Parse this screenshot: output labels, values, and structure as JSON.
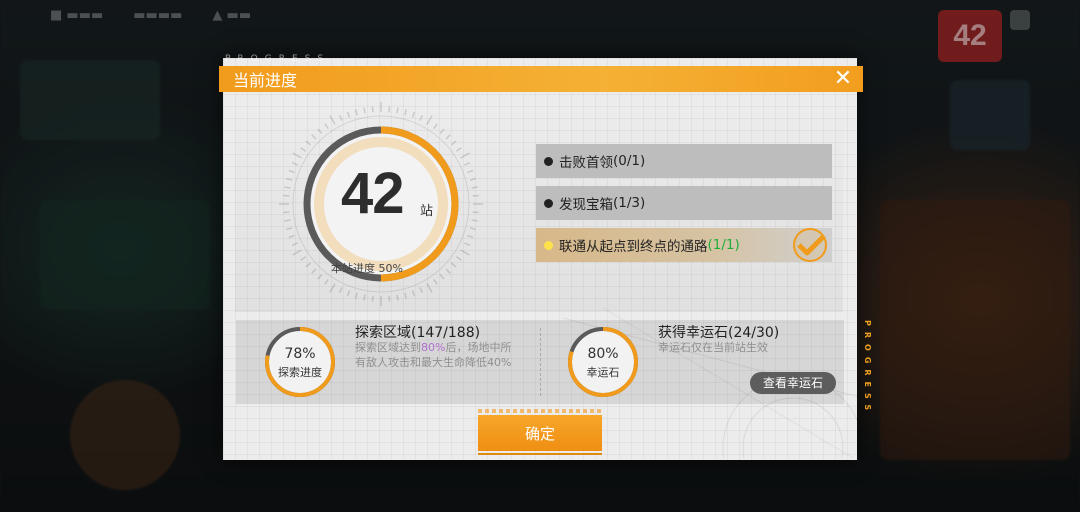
{
  "background": {
    "hud_badge_number": "42"
  },
  "dialog": {
    "watermark": "PROGRESS",
    "side_label": "PROGRESS",
    "title": "当前进度",
    "close_glyph": "✕",
    "station": {
      "number": "42",
      "unit": "站",
      "sub_label": "本站进度",
      "sub_value": "50%",
      "progress_fraction": 0.5
    },
    "objectives": [
      {
        "text": "击败首领",
        "count": "(0/1)",
        "done": false
      },
      {
        "text": "发现宝箱",
        "count": "(1/3)",
        "done": false
      },
      {
        "text": "联通从起点到终点的通路",
        "count": "(1/1)",
        "done": true
      }
    ],
    "explore": {
      "pct": "78%",
      "caption": "探索进度",
      "fraction": 0.78,
      "title": "探索区域(147/188)",
      "desc_1": "探索区域达到",
      "desc_hl": "80%",
      "desc_2": "后，场地中所",
      "desc_3": "有敌人攻击和最大生命降低40%"
    },
    "luck": {
      "pct": "80%",
      "caption": "幸运石",
      "fraction": 0.8,
      "title": "获得幸运石(24/30)",
      "desc": "幸运石仅在当前站生效",
      "button": "查看幸运石"
    },
    "confirm": "确定"
  },
  "colors": {
    "accent": "#f19b1c",
    "ring_track": "#5a5a5a",
    "objective_ok": "#1fae3a"
  }
}
